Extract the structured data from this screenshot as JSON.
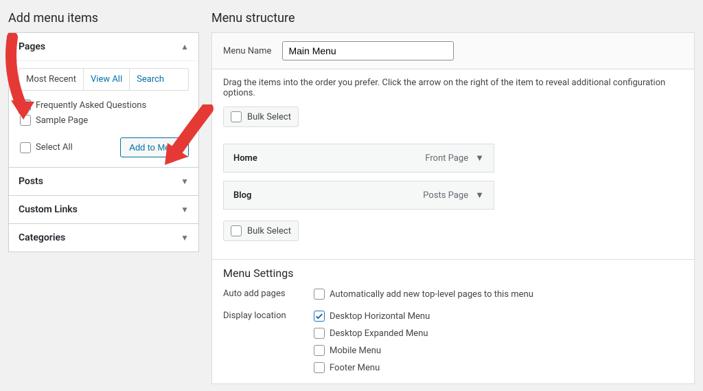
{
  "left": {
    "heading": "Add menu items",
    "pages_label": "Pages",
    "tabs": {
      "recent": "Most Recent",
      "all": "View All",
      "search": "Search"
    },
    "items": [
      {
        "label": "Frequently Asked Questions",
        "checked": true
      },
      {
        "label": "Sample Page",
        "checked": false
      }
    ],
    "select_all": "Select All",
    "add_btn": "Add to Menu",
    "posts_label": "Posts",
    "custom_links_label": "Custom Links",
    "categories_label": "Categories"
  },
  "right": {
    "heading": "Menu structure",
    "menu_name_label": "Menu Name",
    "menu_name_value": "Main Menu",
    "instructions": "Drag the items into the order you prefer. Click the arrow on the right of the item to reveal additional configuration options.",
    "bulk_select": "Bulk Select",
    "items": [
      {
        "title": "Home",
        "type": "Front Page"
      },
      {
        "title": "Blog",
        "type": "Posts Page"
      }
    ],
    "settings_heading": "Menu Settings",
    "auto_add_label": "Auto add pages",
    "auto_add_option": "Automatically add new top-level pages to this menu",
    "display_location_label": "Display location",
    "locations": [
      {
        "label": "Desktop Horizontal Menu",
        "checked": true
      },
      {
        "label": "Desktop Expanded Menu",
        "checked": false
      },
      {
        "label": "Mobile Menu",
        "checked": false
      },
      {
        "label": "Footer Menu",
        "checked": false
      }
    ]
  }
}
